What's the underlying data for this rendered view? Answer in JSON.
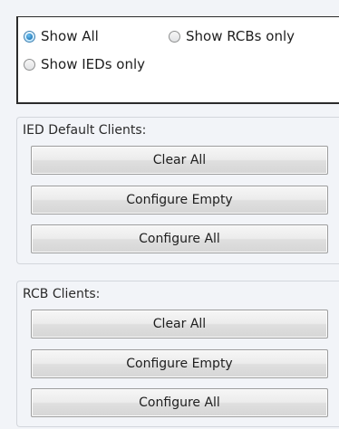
{
  "filter": {
    "options": [
      {
        "label": "Show All",
        "checked": true
      },
      {
        "label": "Show RCBs only",
        "checked": false
      },
      {
        "label": "Show IEDs only",
        "checked": false
      }
    ]
  },
  "ied_group": {
    "title": "IED Default Clients:",
    "buttons": [
      "Clear All",
      "Configure Empty",
      "Configure All"
    ]
  },
  "rcb_group": {
    "title": "RCB Clients:",
    "buttons": [
      "Clear All",
      "Configure Empty",
      "Configure All"
    ]
  }
}
